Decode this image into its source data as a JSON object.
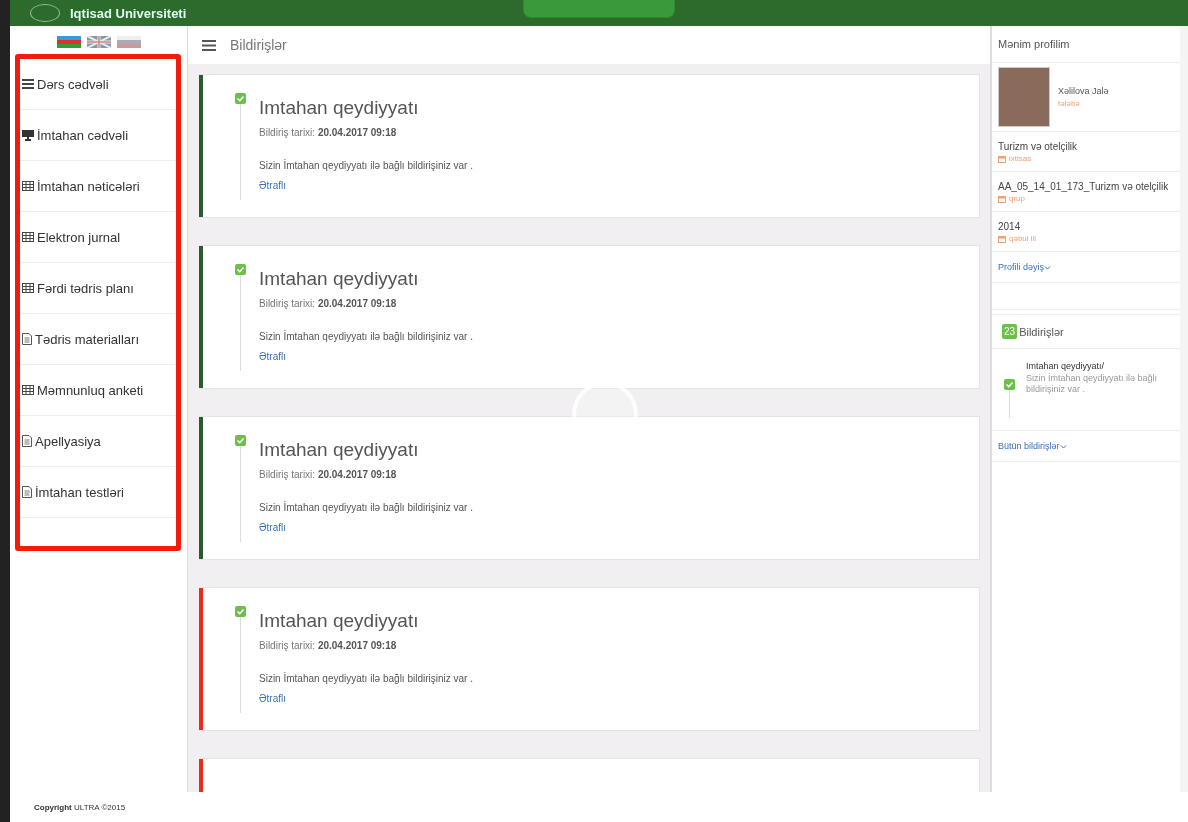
{
  "header": {
    "title": "Iqtisad Universiteti"
  },
  "languages": [
    {
      "kind": "azerbaijan"
    },
    {
      "kind": "uk"
    },
    {
      "kind": "russia"
    }
  ],
  "sidebar": {
    "items": [
      {
        "label": "Dərs cədvəli",
        "kind": "list"
      },
      {
        "label": "İmtahan cədvəli",
        "kind": "monitor"
      },
      {
        "label": "İmtahan nəticələri",
        "kind": "table"
      },
      {
        "label": "Elektron jurnal",
        "kind": "table"
      },
      {
        "label": "Fərdi tədris planı",
        "kind": "table"
      },
      {
        "label": "Tədris materialları",
        "kind": "doc"
      },
      {
        "label": "Məmnunluq anketi",
        "kind": "table"
      },
      {
        "label": "Apellyasiya",
        "kind": "doc"
      },
      {
        "label": "İmtahan testləri",
        "kind": "doc"
      }
    ]
  },
  "toolbar": {
    "title": "Bildirişlər"
  },
  "notifications": [
    {
      "title": "Imtahan qeydiyyatı",
      "date_label": "Bildiriş tarixi:",
      "date": "20.04.2017 09:18",
      "message": "Sizin İmtahan qeydiyyatı ilə bağlı bildirişiniz var .",
      "link": "Ətraflı",
      "color": "#2d5a2d"
    },
    {
      "title": "Imtahan qeydiyyatı",
      "date_label": "Bildiriş tarixi:",
      "date": "20.04.2017 09:18",
      "message": "Sizin İmtahan qeydiyyatı ilə bağlı bildirişiniz var .",
      "link": "Ətraflı",
      "color": "#2d5a2d"
    },
    {
      "title": "Imtahan qeydiyyatı",
      "date_label": "Bildiriş tarixi:",
      "date": "20.04.2017 09:18",
      "message": "Sizin İmtahan qeydiyyatı ilə bağlı bildirişiniz var .",
      "link": "Ətraflı",
      "color": "#2d5a2d"
    },
    {
      "title": "Imtahan qeydiyyatı",
      "date_label": "Bildiriş tarixi:",
      "date": "20.04.2017 09:18",
      "message": "Sizin İmtahan qeydiyyatı ilə bağlı bildirişiniz var .",
      "link": "Ətraflı",
      "color": "#ee2a1b"
    },
    {
      "color": "#ee2a1b"
    }
  ],
  "profile": {
    "heading": "Mənim profilim",
    "name": "Xəlilova Jalə",
    "role": "tələbə",
    "fields": [
      {
        "value": "Turizm və otelçilik",
        "label": "ixtisas"
      },
      {
        "value": "AA_05_14_01_173_Turizm və otelçilik",
        "label": "qrup"
      },
      {
        "value": "2014",
        "label": "qəbul ili"
      }
    ],
    "edit_link": "Profili dəyiş"
  },
  "notif_panel": {
    "count": "23",
    "heading": "Bildirişlər",
    "items": [
      {
        "title": "Imtahan qeydiyyatı/",
        "text": "Sizin İmtahan qeydiyyatı ilə bağlı bildirişiniz var ."
      }
    ],
    "all_link": "Bütün bildirişlər"
  },
  "footer": {
    "brand": "Copyright",
    "text": "ULTRA ©2015"
  }
}
